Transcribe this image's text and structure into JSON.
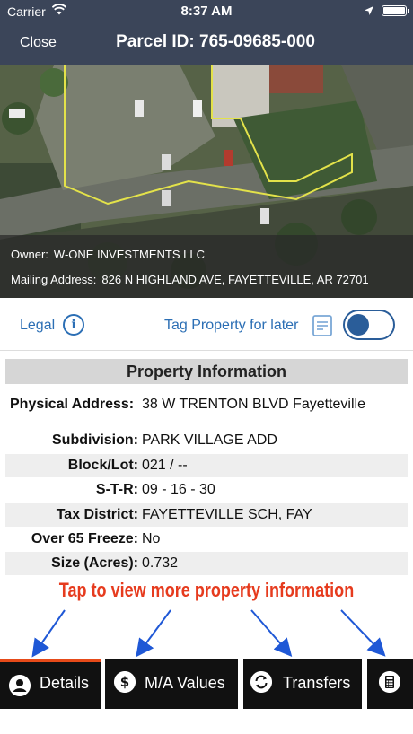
{
  "status_bar": {
    "carrier": "Carrier",
    "time": "8:37 AM"
  },
  "nav": {
    "close_label": "Close",
    "title": "Parcel ID: 765-09685-000"
  },
  "map_overlay": {
    "owner_label": "Owner:",
    "owner_value": "W-ONE INVESTMENTS LLC",
    "mailing_label": "Mailing Address:",
    "mailing_value": "826 N HIGHLAND AVE, FAYETTEVILLE, AR 72701"
  },
  "toolbar": {
    "legal_label": "Legal",
    "info_icon": "info-icon",
    "tag_label": "Tag Property for later",
    "note_icon": "note-icon",
    "toggle_on": true
  },
  "property_info": {
    "title": "Property Information",
    "rows": [
      {
        "key": "Physical Address:",
        "value": "38 W TRENTON BLVD Fayetteville"
      },
      {
        "key": "Subdivision:",
        "value": "PARK VILLAGE ADD"
      },
      {
        "key": "Block/Lot:",
        "value": "021 / --"
      },
      {
        "key": "S-T-R:",
        "value": "09 - 16 - 30"
      },
      {
        "key": "Tax District:",
        "value": "FAYETTEVILLE SCH, FAY"
      },
      {
        "key": "Over 65 Freeze:",
        "value": "No"
      },
      {
        "key": "Size (Acres):",
        "value": "0.732"
      }
    ]
  },
  "hint": "Tap to view more property information",
  "tabs": [
    {
      "label": "Details",
      "icon": "person-icon"
    },
    {
      "label": "M/A Values",
      "icon": "dollar-icon"
    },
    {
      "label": "Transfers",
      "icon": "refresh-icon"
    },
    {
      "label": "",
      "icon": "calculator-icon"
    }
  ],
  "colors": {
    "nav": "#3b4559",
    "accent": "#2c6fb5",
    "hint": "#e63b1e",
    "active_tab": "#e64a19"
  }
}
